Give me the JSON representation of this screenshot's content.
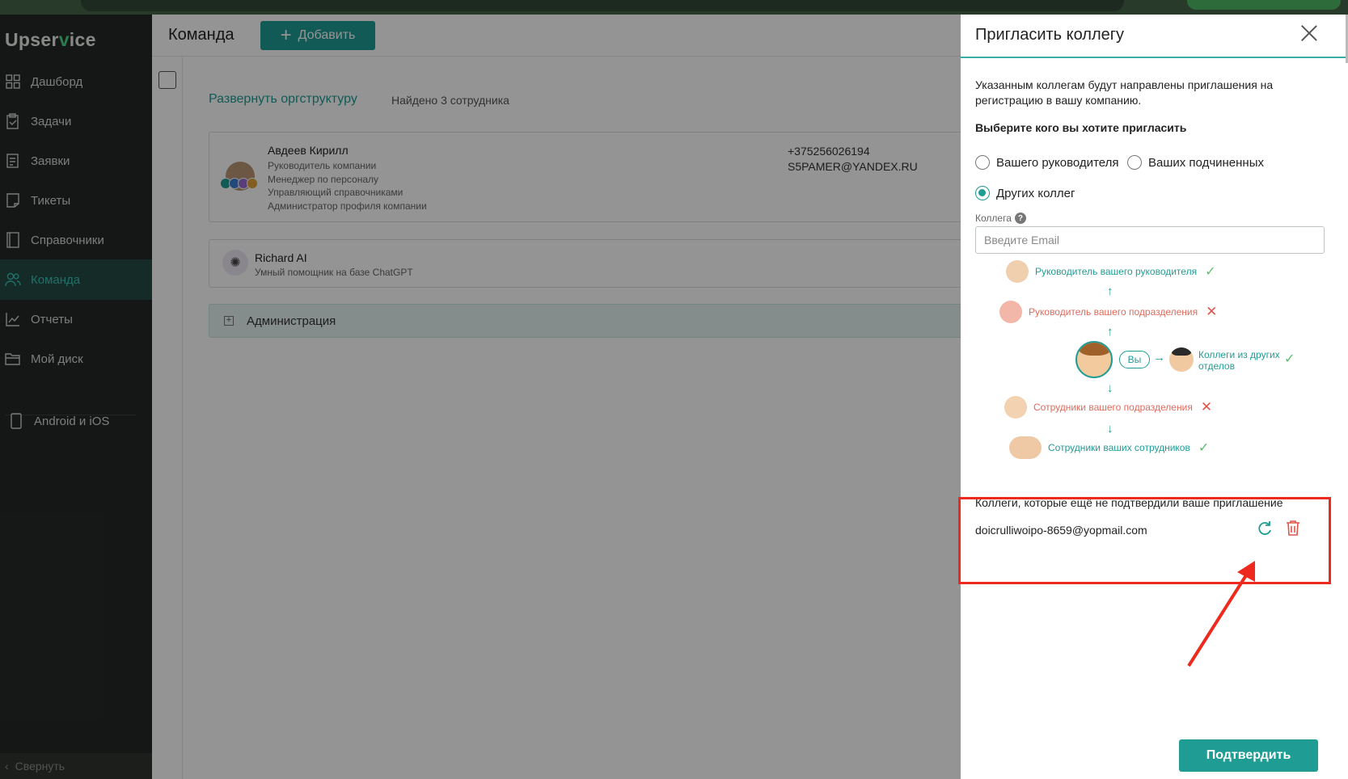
{
  "app": {
    "logo_prefix": "Upser",
    "logo_v": "v",
    "logo_suffix": "ice"
  },
  "sidebar": {
    "items": [
      {
        "label": "Дашборд",
        "icon": "dashboard-icon"
      },
      {
        "label": "Задачи",
        "icon": "tasks-icon"
      },
      {
        "label": "Заявки",
        "icon": "requests-icon"
      },
      {
        "label": "Тикеты",
        "icon": "tickets-icon"
      },
      {
        "label": "Справочники",
        "icon": "book-icon"
      },
      {
        "label": "Команда",
        "icon": "team-icon",
        "active": true
      },
      {
        "label": "Отчеты",
        "icon": "reports-icon"
      },
      {
        "label": "Мой диск",
        "icon": "folder-icon"
      }
    ],
    "mobile": "Android и iOS",
    "collapse": "Свернуть"
  },
  "main": {
    "title": "Команда",
    "add_label": "Добавить",
    "expand_link": "Развернуть оргструктуру",
    "found": "Найдено 3 сотрудника",
    "person": {
      "name": "Авдеев Кирилл",
      "roles": [
        "Руководитель компании",
        "Менеджер по персоналу",
        "Управляющий справочниками",
        "Администратор профиля компании"
      ],
      "phone": "+375256026194",
      "email": "S5PAMER@YANDEX.RU"
    },
    "ai": {
      "name": "Richard AI",
      "desc": "Умный помощник на базе ChatGPT"
    },
    "department": "Администрация"
  },
  "panel": {
    "title": "Пригласить коллегу",
    "intro": "Указанным коллегам будут направлены приглашения на регистрацию в вашу компанию.",
    "choose": "Выберите кого вы хотите пригласить",
    "radios": [
      "Вашего руководителя",
      "Ваших подчиненных",
      "Других коллег"
    ],
    "selected_radio": "Других коллег",
    "field_label": "Коллега",
    "email_placeholder": "Введите Email",
    "hierarchy": {
      "boss_of_boss": "Руководитель вашего руководителя",
      "dept_head": "Руководитель вашего подразделения",
      "me": "Вы",
      "other_depts": "Коллеги из других отделов",
      "dept_staff": "Сотрудники вашего подразделения",
      "subordinates_staff": "Сотрудники ваших сотрудников"
    },
    "pending_title": "Коллеги, которые ещё не подтвердили ваше приглашение",
    "pending_email": "doicrulliwoipo-8659@yopmail.com",
    "confirm": "Подтвердить"
  },
  "colors": {
    "accent": "#1f9c94",
    "sidebar_bg": "#252926",
    "error": "#e0554a",
    "ok": "#5bc06a",
    "highlight": "#ee2a1e"
  }
}
